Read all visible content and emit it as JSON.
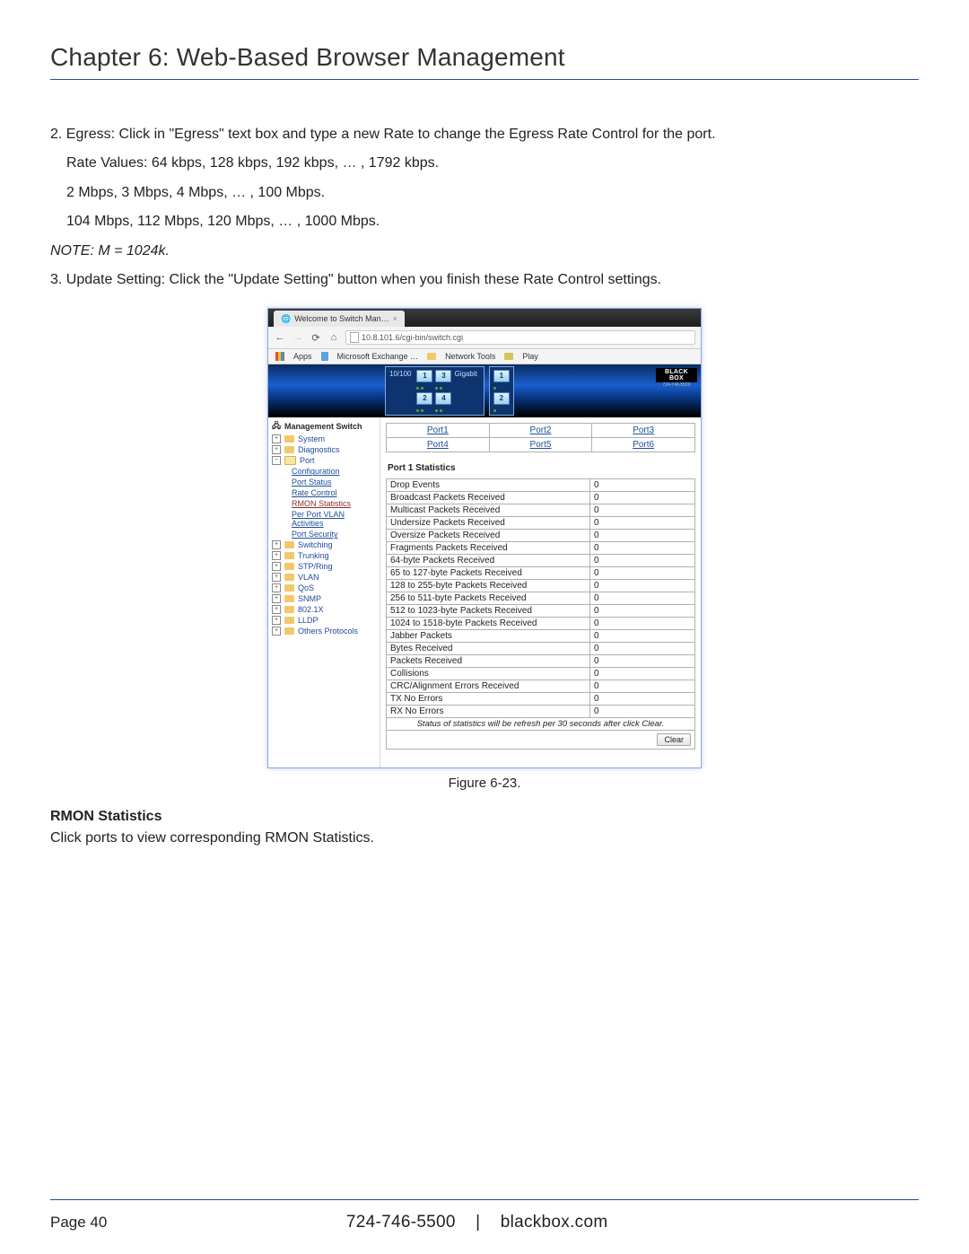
{
  "chapter_title": "Chapter 6: Web-Based Browser Management",
  "body": {
    "p1": "2. Egress: Click in \"Egress\" text box and type a new Rate to change the Egress Rate Control for the port.",
    "p2": "Rate Values: 64 kbps, 128 kbps, 192 kbps, … , 1792 kbps.",
    "p3": "2 Mbps, 3 Mbps, 4 Mbps, … , 100 Mbps.",
    "p4": "104 Mbps, 112 Mbps, 120 Mbps, … , 1000 Mbps.",
    "note": "NOTE: M = 1024k.",
    "p5": "3.  Update Setting: Click the \"Update Setting\" button when you finish these Rate Control settings."
  },
  "screenshot": {
    "tab_title": "Welcome to Switch Man…",
    "url": "10.8.101.6/cgi-bin/switch.cgi",
    "bookmarks": {
      "apps": "Apps",
      "b1": "Microsoft Exchange …",
      "b2": "Network Tools",
      "b3": "Play"
    },
    "banner": {
      "left_label": "10/100",
      "right_label": "Gigabit",
      "ports_left": [
        "1",
        "3",
        "2",
        "4"
      ],
      "ports_right": [
        "1",
        "2"
      ],
      "brand": "BLACK BOX",
      "brand_sub": "724-746-5500"
    },
    "navtree": {
      "root": "Management Switch",
      "items": [
        {
          "type": "folder",
          "label": "System"
        },
        {
          "type": "folder",
          "label": "Diagnostics"
        },
        {
          "type": "folder-open",
          "label": "Port",
          "children": [
            "Configuration",
            "Port Status",
            "Rate Control",
            "RMON Statistics",
            "Per Port VLAN Activities",
            "Port Security"
          ]
        },
        {
          "type": "folder",
          "label": "Switching"
        },
        {
          "type": "folder",
          "label": "Trunking"
        },
        {
          "type": "folder",
          "label": "STP/Ring"
        },
        {
          "type": "folder",
          "label": "VLAN"
        },
        {
          "type": "folder",
          "label": "QoS"
        },
        {
          "type": "folder",
          "label": "SNMP"
        },
        {
          "type": "folder",
          "label": "802.1X"
        },
        {
          "type": "folder",
          "label": "LLDP"
        },
        {
          "type": "folder",
          "label": "Others Protocols"
        }
      ],
      "active_leaf": "RMON Statistics"
    },
    "port_links": [
      [
        "Port1",
        "Port2",
        "Port3"
      ],
      [
        "Port4",
        "Port5",
        "Port6"
      ]
    ],
    "stats_title": "Port 1 Statistics",
    "stats_rows": [
      [
        "Drop Events",
        "0"
      ],
      [
        "Broadcast Packets Received",
        "0"
      ],
      [
        "Multicast Packets Received",
        "0"
      ],
      [
        "Undersize Packets Received",
        "0"
      ],
      [
        "Oversize Packets Received",
        "0"
      ],
      [
        "Fragments Packets Received",
        "0"
      ],
      [
        "64-byte Packets Received",
        "0"
      ],
      [
        "65 to 127-byte Packets Received",
        "0"
      ],
      [
        "128 to 255-byte Packets Received",
        "0"
      ],
      [
        "256 to 511-byte Packets Received",
        "0"
      ],
      [
        "512 to 1023-byte Packets Received",
        "0"
      ],
      [
        "1024 to 1518-byte Packets Received",
        "0"
      ],
      [
        "Jabber Packets",
        "0"
      ],
      [
        "Bytes Received",
        "0"
      ],
      [
        "Packets Received",
        "0"
      ],
      [
        "Collisions",
        "0"
      ],
      [
        "CRC/Alignment Errors Received",
        "0"
      ],
      [
        "TX No Errors",
        "0"
      ],
      [
        "RX No Errors",
        "0"
      ]
    ],
    "stats_note": "Status of statistics will be refresh per 30 seconds after click Clear.",
    "clear_label": "Clear"
  },
  "figure_caption": "Figure 6-23.",
  "section_title": "RMON Statistics",
  "section_text": "Click ports to view corresponding RMON Statistics.",
  "footer": {
    "page": "Page 40",
    "center_phone": "724-746-5500",
    "center_sep": "|",
    "center_site": "blackbox.com"
  }
}
